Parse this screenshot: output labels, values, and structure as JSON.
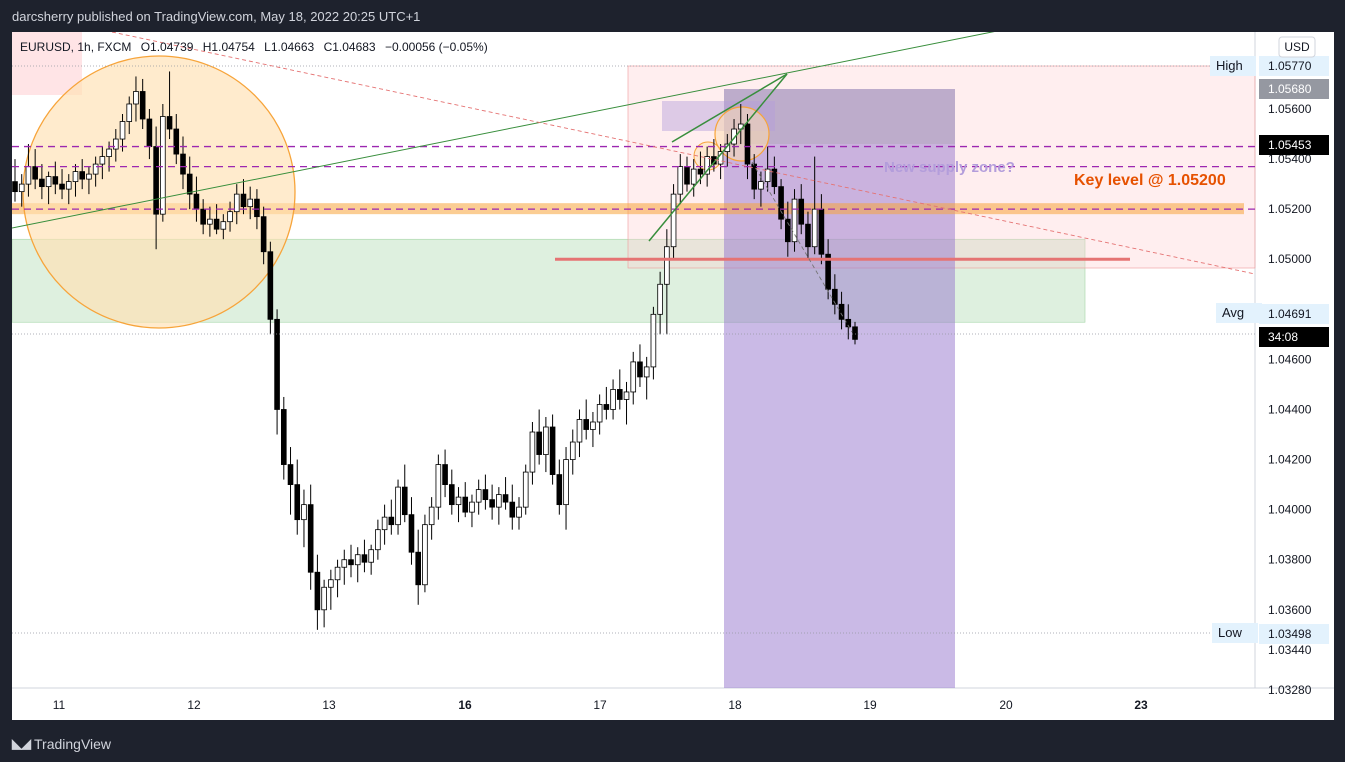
{
  "header": {
    "published": "darcsherry published on TradingView.com, May 18, 2022 20:25 UTC+1"
  },
  "legend": {
    "symbol": "EURUSD, 1h, FXCM",
    "o": "O1.04739",
    "h": "H1.04754",
    "l": "L1.04663",
    "c": "C1.04683",
    "chg": "−0.00056 (−0.05%)"
  },
  "currency": "USD",
  "footer": {
    "brand": "TradingView",
    "logo_icon": "tradingview-logo-icon"
  },
  "annotations": {
    "key_level": "Key level @ 1.05200",
    "supply": "New supply zone?"
  },
  "axis_tags": {
    "high_label": "High",
    "high_value": "1.05770",
    "open_value": "1.05680",
    "current_value": "1.05453",
    "avg_label": "Avg",
    "avg_value": "1.04691",
    "countdown": "34:08",
    "low_label": "Low",
    "low_value": "1.03498"
  },
  "colors": {
    "up": "#ffffff",
    "down": "#000000",
    "candle_border": "#000000",
    "zone_orange": "#f7a43a",
    "zone_purple": "#9c27b0",
    "zone_red": "#e57373",
    "zone_green": "#c8e6c9",
    "trend_green": "#388e3c",
    "projection_purple": "#9575cd"
  },
  "chart_data": {
    "type": "candlestick",
    "instrument": "EURUSD",
    "timeframe": "1h",
    "ylim": [
      1.0328,
      1.0586
    ],
    "y_ticks": [
      "1.05600",
      "1.05400",
      "1.05200",
      "1.05000",
      "1.04800",
      "1.04600",
      "1.04400",
      "1.04200",
      "1.04000",
      "1.03800",
      "1.03600",
      "1.03440",
      "1.03280"
    ],
    "x_ticks": [
      "11",
      "12",
      "13",
      "16",
      "17",
      "18",
      "19",
      "20",
      "23"
    ],
    "key_levels": [
      1.052,
      1.0545,
      1.0537,
      1.052,
      1.05
    ],
    "ohlc": [
      [
        1.0531,
        1.054,
        1.0523,
        1.0527
      ],
      [
        1.0527,
        1.0534,
        1.0521,
        1.053
      ],
      [
        1.053,
        1.0546,
        1.0525,
        1.0537
      ],
      [
        1.0537,
        1.0544,
        1.0528,
        1.0532
      ],
      [
        1.0532,
        1.0538,
        1.0524,
        1.0529
      ],
      [
        1.0529,
        1.0535,
        1.0522,
        1.0533
      ],
      [
        1.0533,
        1.0539,
        1.0526,
        1.053
      ],
      [
        1.053,
        1.0536,
        1.0524,
        1.0528
      ],
      [
        1.0528,
        1.0534,
        1.0522,
        1.0531
      ],
      [
        1.0531,
        1.0538,
        1.0525,
        1.0535
      ],
      [
        1.0535,
        1.054,
        1.0528,
        1.0532
      ],
      [
        1.0532,
        1.0537,
        1.0526,
        1.0534
      ],
      [
        1.0534,
        1.0541,
        1.0529,
        1.0538
      ],
      [
        1.0538,
        1.0545,
        1.0532,
        1.0541
      ],
      [
        1.0541,
        1.0547,
        1.0535,
        1.0544
      ],
      [
        1.0544,
        1.0552,
        1.0539,
        1.0548
      ],
      [
        1.0548,
        1.0558,
        1.0543,
        1.0555
      ],
      [
        1.0555,
        1.0565,
        1.055,
        1.0562
      ],
      [
        1.0562,
        1.0573,
        1.0555,
        1.0567
      ],
      [
        1.0567,
        1.0572,
        1.0552,
        1.0556
      ],
      [
        1.0556,
        1.056,
        1.054,
        1.0545
      ],
      [
        1.0545,
        1.0553,
        1.0504,
        1.0518
      ],
      [
        1.0518,
        1.0562,
        1.0515,
        1.0557
      ],
      [
        1.0557,
        1.0575,
        1.0548,
        1.0552
      ],
      [
        1.0552,
        1.0558,
        1.0538,
        1.0542
      ],
      [
        1.0542,
        1.0549,
        1.0528,
        1.0534
      ],
      [
        1.0534,
        1.0541,
        1.052,
        1.0526
      ],
      [
        1.0526,
        1.0533,
        1.0515,
        1.052
      ],
      [
        1.052,
        1.0524,
        1.051,
        1.0514
      ],
      [
        1.0514,
        1.0521,
        1.0509,
        1.0516
      ],
      [
        1.0516,
        1.0522,
        1.051,
        1.0512
      ],
      [
        1.0512,
        1.0518,
        1.0508,
        1.0515
      ],
      [
        1.0515,
        1.0523,
        1.0511,
        1.0519
      ],
      [
        1.0519,
        1.053,
        1.0514,
        1.0526
      ],
      [
        1.0526,
        1.0532,
        1.0518,
        1.0521
      ],
      [
        1.0521,
        1.0529,
        1.0516,
        1.0524
      ],
      [
        1.0524,
        1.0528,
        1.0512,
        1.0517
      ],
      [
        1.0517,
        1.0521,
        1.0498,
        1.0503
      ],
      [
        1.0503,
        1.0507,
        1.047,
        1.0476
      ],
      [
        1.0476,
        1.048,
        1.043,
        1.044
      ],
      [
        1.044,
        1.0445,
        1.0412,
        1.0418
      ],
      [
        1.0418,
        1.0425,
        1.0398,
        1.041
      ],
      [
        1.041,
        1.042,
        1.039,
        1.0396
      ],
      [
        1.0396,
        1.0408,
        1.0385,
        1.0402
      ],
      [
        1.0402,
        1.041,
        1.0368,
        1.0375
      ],
      [
        1.0375,
        1.0382,
        1.0352,
        1.036
      ],
      [
        1.036,
        1.0372,
        1.0353,
        1.0369
      ],
      [
        1.0369,
        1.0376,
        1.036,
        1.0372
      ],
      [
        1.0372,
        1.038,
        1.0365,
        1.0377
      ],
      [
        1.0377,
        1.0384,
        1.037,
        1.038
      ],
      [
        1.038,
        1.0386,
        1.0373,
        1.0378
      ],
      [
        1.0378,
        1.0385,
        1.0371,
        1.0382
      ],
      [
        1.0382,
        1.0388,
        1.0375,
        1.0379
      ],
      [
        1.0379,
        1.0386,
        1.0374,
        1.0384
      ],
      [
        1.0384,
        1.0396,
        1.038,
        1.0392
      ],
      [
        1.0392,
        1.0402,
        1.0386,
        1.0397
      ],
      [
        1.0397,
        1.0404,
        1.039,
        1.0394
      ],
      [
        1.0394,
        1.0412,
        1.039,
        1.0409
      ],
      [
        1.0409,
        1.0418,
        1.0395,
        1.0398
      ],
      [
        1.0398,
        1.0405,
        1.0378,
        1.0383
      ],
      [
        1.0383,
        1.0392,
        1.0362,
        1.037
      ],
      [
        1.037,
        1.0398,
        1.0367,
        1.0394
      ],
      [
        1.0394,
        1.0405,
        1.0388,
        1.0401
      ],
      [
        1.0401,
        1.0422,
        1.0396,
        1.0418
      ],
      [
        1.0418,
        1.0424,
        1.0405,
        1.041
      ],
      [
        1.041,
        1.0416,
        1.0398,
        1.0402
      ],
      [
        1.0402,
        1.0409,
        1.0395,
        1.0405
      ],
      [
        1.0405,
        1.0411,
        1.0397,
        1.0399
      ],
      [
        1.0399,
        1.0406,
        1.0393,
        1.0403
      ],
      [
        1.0403,
        1.0412,
        1.0398,
        1.0408
      ],
      [
        1.0408,
        1.0414,
        1.04,
        1.0404
      ],
      [
        1.0404,
        1.041,
        1.0396,
        1.0401
      ],
      [
        1.0401,
        1.0409,
        1.0394,
        1.0406
      ],
      [
        1.0406,
        1.0413,
        1.04,
        1.0403
      ],
      [
        1.0403,
        1.041,
        1.0392,
        1.0397
      ],
      [
        1.0397,
        1.0405,
        1.0392,
        1.0401
      ],
      [
        1.0401,
        1.0418,
        1.0398,
        1.0415
      ],
      [
        1.0415,
        1.0435,
        1.041,
        1.0431
      ],
      [
        1.0431,
        1.044,
        1.0418,
        1.0422
      ],
      [
        1.0422,
        1.0437,
        1.0415,
        1.0433
      ],
      [
        1.0433,
        1.0438,
        1.041,
        1.0414
      ],
      [
        1.0414,
        1.042,
        1.0398,
        1.0402
      ],
      [
        1.0402,
        1.0425,
        1.0392,
        1.042
      ],
      [
        1.042,
        1.0432,
        1.0414,
        1.0427
      ],
      [
        1.0427,
        1.044,
        1.0421,
        1.0436
      ],
      [
        1.0436,
        1.0444,
        1.0428,
        1.0432
      ],
      [
        1.0432,
        1.0439,
        1.0425,
        1.0435
      ],
      [
        1.0435,
        1.0446,
        1.043,
        1.0442
      ],
      [
        1.0442,
        1.0449,
        1.0436,
        1.044
      ],
      [
        1.044,
        1.0452,
        1.0436,
        1.0448
      ],
      [
        1.0448,
        1.0456,
        1.044,
        1.0444
      ],
      [
        1.0444,
        1.0451,
        1.0434,
        1.0447
      ],
      [
        1.0447,
        1.0463,
        1.0442,
        1.0459
      ],
      [
        1.0459,
        1.0466,
        1.0449,
        1.0453
      ],
      [
        1.0453,
        1.0461,
        1.0444,
        1.0457
      ],
      [
        1.0457,
        1.0481,
        1.0452,
        1.0478
      ],
      [
        1.0478,
        1.0495,
        1.047,
        1.049
      ],
      [
        1.049,
        1.0512,
        1.047,
        1.0505
      ],
      [
        1.0505,
        1.053,
        1.05,
        1.0526
      ],
      [
        1.0526,
        1.0542,
        1.0522,
        1.0537
      ],
      [
        1.0537,
        1.0541,
        1.0527,
        1.053
      ],
      [
        1.053,
        1.054,
        1.0525,
        1.0536
      ],
      [
        1.0536,
        1.0543,
        1.053,
        1.0534
      ],
      [
        1.0534,
        1.0545,
        1.0529,
        1.0541
      ],
      [
        1.0541,
        1.0548,
        1.0535,
        1.0538
      ],
      [
        1.0538,
        1.0546,
        1.0532,
        1.0543
      ],
      [
        1.0543,
        1.055,
        1.0537,
        1.0546
      ],
      [
        1.0546,
        1.0556,
        1.0541,
        1.0552
      ],
      [
        1.0552,
        1.0562,
        1.0546,
        1.0554
      ],
      [
        1.0554,
        1.0558,
        1.0532,
        1.0538
      ],
      [
        1.0538,
        1.0542,
        1.0524,
        1.0528
      ],
      [
        1.0528,
        1.0535,
        1.0521,
        1.0531
      ],
      [
        1.0531,
        1.0545,
        1.0527,
        1.0536
      ],
      [
        1.0536,
        1.0541,
        1.0526,
        1.0529
      ],
      [
        1.0529,
        1.0532,
        1.0512,
        1.0516
      ],
      [
        1.0516,
        1.0523,
        1.0501,
        1.0507
      ],
      [
        1.0507,
        1.0528,
        1.0503,
        1.0524
      ],
      [
        1.0524,
        1.053,
        1.051,
        1.0514
      ],
      [
        1.0514,
        1.0519,
        1.05,
        1.0505
      ],
      [
        1.0505,
        1.0541,
        1.0502,
        1.052
      ],
      [
        1.052,
        1.0526,
        1.0498,
        1.0502
      ],
      [
        1.0502,
        1.0508,
        1.0484,
        1.0488
      ],
      [
        1.0488,
        1.0494,
        1.0478,
        1.0482
      ],
      [
        1.0482,
        1.0487,
        1.0472,
        1.0476
      ],
      [
        1.0476,
        1.0482,
        1.0468,
        1.0473
      ],
      [
        1.0473,
        1.0475,
        1.0466,
        1.0468
      ]
    ],
    "x_ticks_pos": []
  }
}
